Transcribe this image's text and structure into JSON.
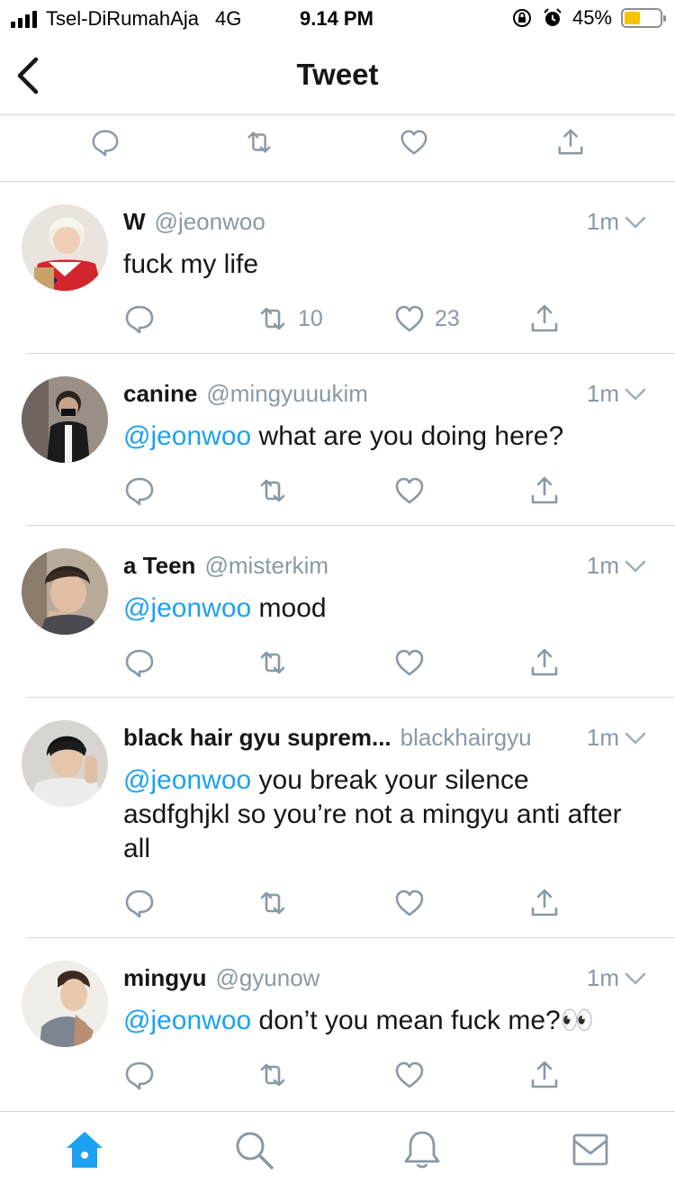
{
  "status_bar": {
    "carrier": "Tsel-DiRumahAja",
    "network": "4G",
    "time": "9.14 PM",
    "battery": "45%",
    "battery_level": 0.45
  },
  "header": {
    "title": "Tweet"
  },
  "replies": [
    {
      "name": "W",
      "handle": "@jeonwoo",
      "time": "1m",
      "mention": "",
      "text": "fuck my life",
      "retweets": "10",
      "likes": "23"
    },
    {
      "name": "canine",
      "handle": "@mingyuuukim",
      "time": "1m",
      "mention": "@jeonwoo",
      "text": " what are you doing here?",
      "retweets": "",
      "likes": ""
    },
    {
      "name": "a Teen",
      "handle": "@misterkim",
      "time": "1m",
      "mention": "@jeonwoo",
      "text": " mood",
      "retweets": "",
      "likes": ""
    },
    {
      "name": "black hair gyu suprem...",
      "handle": "blackhairgyu",
      "time": "1m",
      "mention": "@jeonwoo",
      "text": " you break your silence asdfghjkl so you’re not a mingyu anti after all",
      "retweets": "",
      "likes": ""
    },
    {
      "name": "mingyu",
      "handle": "@gyunow",
      "time": "1m",
      "mention": "@jeonwoo",
      "text": " don’t you mean fuck me?👀",
      "retweets": "",
      "likes": ""
    }
  ],
  "icons": {
    "back": "chevron-left-icon",
    "reply": "reply-icon",
    "retweet": "retweet-icon",
    "like": "heart-icon",
    "share": "share-icon",
    "tabs": [
      "home-icon",
      "search-icon",
      "bell-icon",
      "mail-icon"
    ]
  },
  "colors": {
    "accent": "#1da1f2",
    "muted": "#8899a6",
    "text": "#14171a"
  }
}
